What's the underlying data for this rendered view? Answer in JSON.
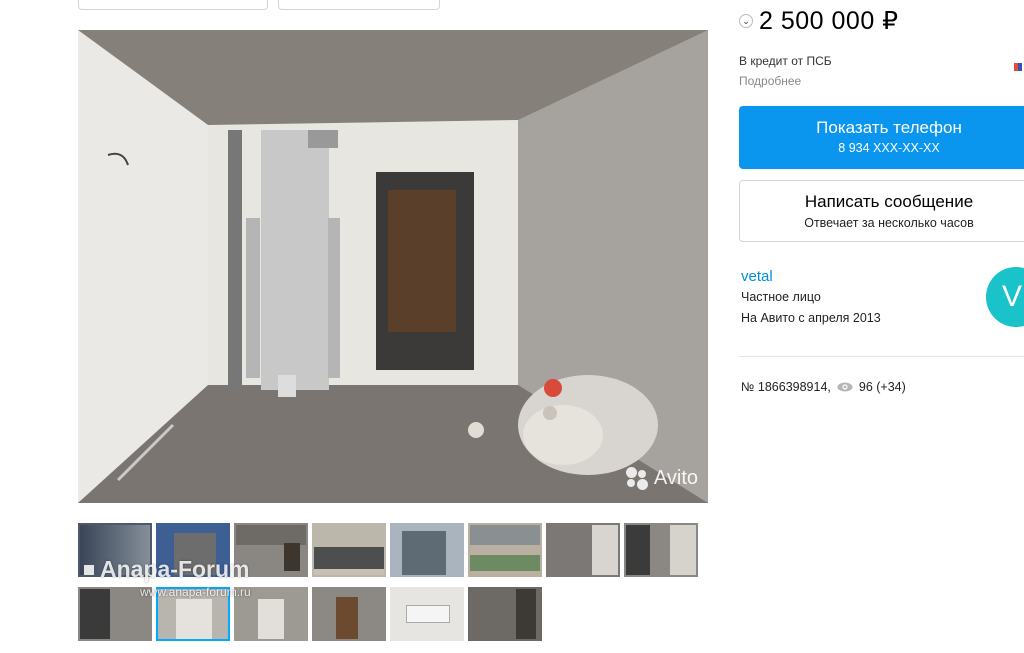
{
  "price": {
    "value": "2 500 000 ₽"
  },
  "credit": {
    "text": "В кредит от ПСБ",
    "more": "Подробнее"
  },
  "contact": {
    "phone_label": "Показать телефон",
    "phone_number": "8 934 XXX-XX-XX",
    "message_label": "Написать сообщение",
    "message_note": "Отвечает за несколько часов"
  },
  "seller": {
    "name": "vetal",
    "type": "Частное лицо",
    "since": "На Авито с апреля 2013",
    "avatar_letter": "V",
    "avatar_color": "#19c3c9"
  },
  "listing": {
    "number": "№ 1866398914,",
    "views": "96 (+34)"
  },
  "photo": {
    "watermark": "Avito",
    "forum_watermark": "Anapa-Forum",
    "forum_url": "www.anapa-forum.ru"
  },
  "colors": {
    "accent": "#0a96ef",
    "link": "#0091d9"
  }
}
